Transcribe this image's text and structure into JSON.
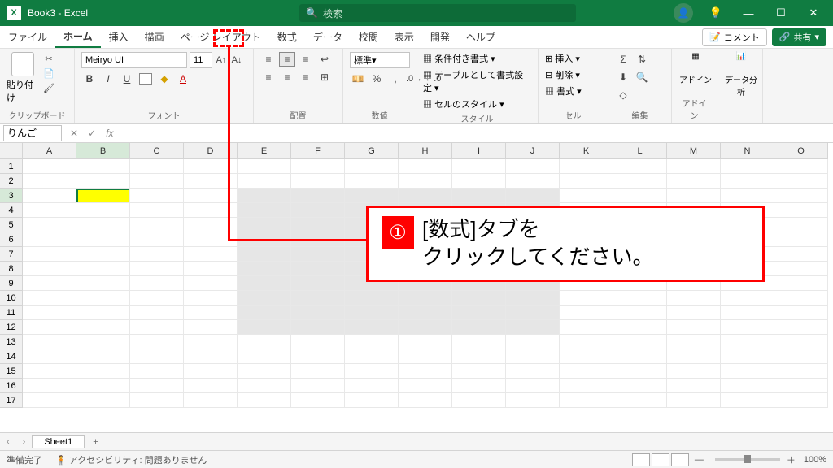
{
  "titlebar": {
    "app_icon": "X",
    "title": "Book3 - Excel",
    "search_placeholder": "検索"
  },
  "tabs": {
    "items": [
      "ファイル",
      "ホーム",
      "挿入",
      "描画",
      "ページ レイアウト",
      "数式",
      "データ",
      "校閲",
      "表示",
      "開発",
      "ヘルプ"
    ],
    "active_index": 1,
    "comment": "コメント",
    "share": "共有"
  },
  "ribbon": {
    "clipboard": {
      "label": "クリップボード",
      "paste": "貼り付け"
    },
    "font": {
      "label": "フォント",
      "name": "Meiryo UI",
      "size": "11",
      "bold": "B",
      "italic": "I",
      "underline": "U"
    },
    "alignment": {
      "label": "配置"
    },
    "number": {
      "label": "数値",
      "format": "標準"
    },
    "styles": {
      "label": "スタイル",
      "cond": "条件付き書式",
      "table": "テーブルとして書式設定",
      "cell": "セルのスタイル"
    },
    "cells": {
      "label": "セル",
      "insert": "挿入",
      "delete": "削除",
      "format": "書式"
    },
    "editing": {
      "label": "編集"
    },
    "addin": {
      "label": "アドイン",
      "btn": "アドイン"
    },
    "analysis": {
      "label": "",
      "btn": "データ分析"
    }
  },
  "fbar": {
    "namebox": "りんご",
    "fx": "fx"
  },
  "grid": {
    "columns": [
      "A",
      "B",
      "C",
      "D",
      "E",
      "F",
      "G",
      "H",
      "I",
      "J",
      "K",
      "L",
      "M",
      "N",
      "O"
    ],
    "rows_shown": 17,
    "selected_cell": {
      "col": 1,
      "row": 2
    }
  },
  "callout": {
    "number": "①",
    "text_line1": "[数式]タブを",
    "text_line2": "クリックしてください。"
  },
  "sheets": {
    "active": "Sheet1"
  },
  "status": {
    "ready": "準備完了",
    "accessibility": "アクセシビリティ: 問題ありません",
    "zoom": "100%"
  }
}
